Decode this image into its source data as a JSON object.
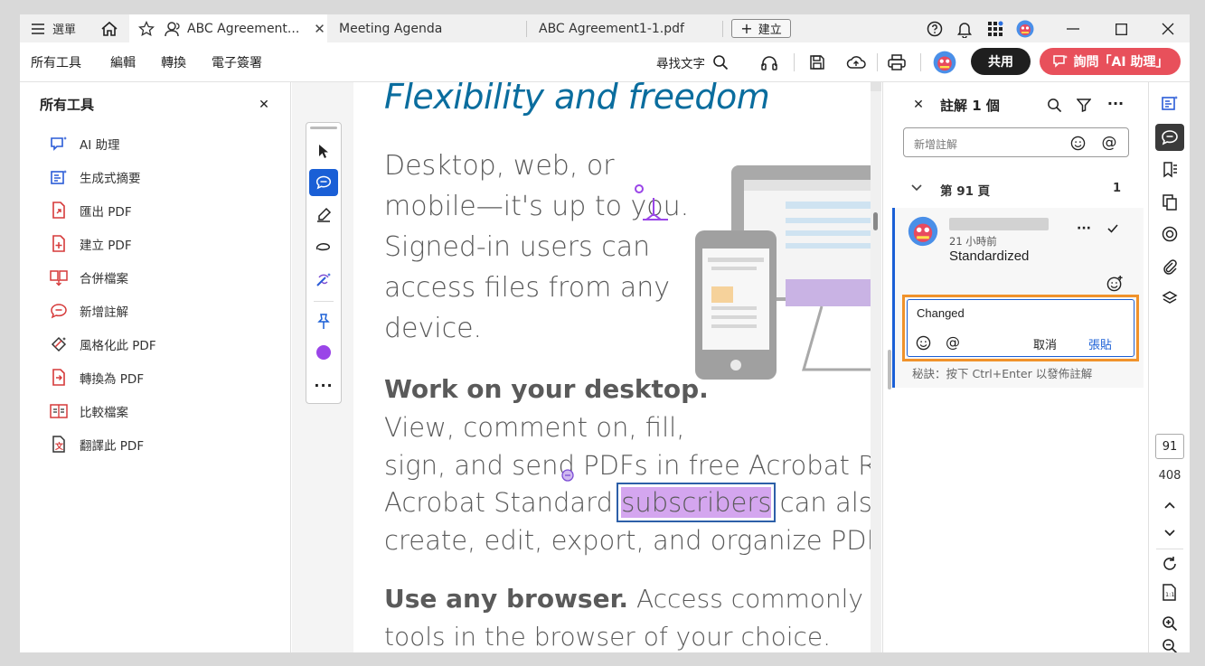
{
  "tabs": {
    "menu_label": "選單",
    "active_tab": "ABC Agreement...",
    "tab2": "Meeting Agenda",
    "tab3": "ABC Agreement1-1.pdf",
    "create_label": "建立"
  },
  "toolbar": {
    "menu": [
      "所有工具",
      "編輯",
      "轉換",
      "電子簽署"
    ],
    "find_text": "尋找文字",
    "share_label": "共用",
    "ai_label": "詢問「AI 助理」"
  },
  "left_panel": {
    "title": "所有工具",
    "tools": [
      {
        "label": "AI 助理",
        "icon": "ai-assistant-icon"
      },
      {
        "label": "生成式摘要",
        "icon": "generative-summary-icon"
      },
      {
        "label": "匯出 PDF",
        "icon": "export-pdf-icon"
      },
      {
        "label": "建立 PDF",
        "icon": "create-pdf-icon"
      },
      {
        "label": "合併檔案",
        "icon": "combine-files-icon"
      },
      {
        "label": "新增註解",
        "icon": "add-comment-icon"
      },
      {
        "label": "風格化此 PDF",
        "icon": "stylize-pdf-icon"
      },
      {
        "label": "轉換為 PDF",
        "icon": "convert-pdf-icon"
      },
      {
        "label": "比較檔案",
        "icon": "compare-files-icon"
      },
      {
        "label": "翻譯此 PDF",
        "icon": "translate-pdf-icon"
      }
    ]
  },
  "document": {
    "heading": "Flexibility and freedom",
    "para1": [
      "Desktop, web, or",
      "mobile—it's up to you.",
      "Signed-in users can",
      "access files from any",
      "device."
    ],
    "section1_title": "Work on your desktop.",
    "section1_lines": [
      "View, comment on, fill,",
      "sign, and send PDFs in free Acrobat Reader.",
      "Acrobat Standard ",
      "subscribers",
      " can also use p",
      "create, edit, export, and organize PDFs."
    ],
    "section2_title": "Use any browser.",
    "section2_rest": " Access commonly used f",
    "section2_line2": "tools in the browser of your choice."
  },
  "comments": {
    "title": "註解 1 個",
    "add_placeholder": "新增註解",
    "page_label": "第 91 頁",
    "page_count": "1",
    "time": "21 小時前",
    "comment_text": "Standardized",
    "reply_value": "Changed",
    "cancel_label": "取消",
    "post_label": "張貼",
    "tip": "秘訣：按下 Ctrl+Enter 以發佈註解"
  },
  "pager": {
    "current_page": "91",
    "total_pages": "408"
  },
  "colors": {
    "accent_blue": "#1a5fd6",
    "ai_button": "#e8505b",
    "highlight": "#d4a6ef",
    "reply_outline": "#f0922b",
    "heading_blue": "#0a6d9e"
  }
}
